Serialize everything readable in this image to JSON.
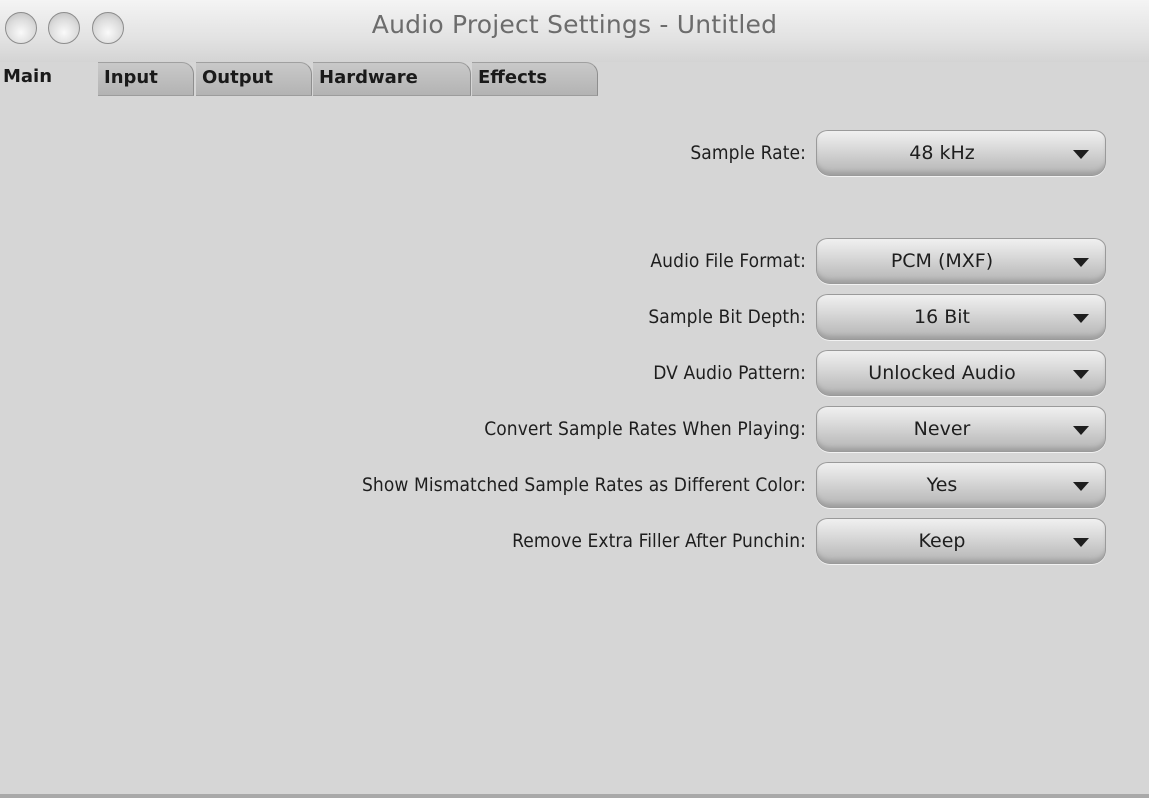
{
  "window": {
    "title": "Audio Project Settings - Untitled"
  },
  "tabs": [
    {
      "label": "Main",
      "active": true
    },
    {
      "label": "Input",
      "active": false
    },
    {
      "label": "Output",
      "active": false
    },
    {
      "label": "Hardware",
      "active": false
    },
    {
      "label": "Effects",
      "active": false
    }
  ],
  "settings": {
    "sample_rate": {
      "label": "Sample Rate:",
      "value": "48 kHz"
    },
    "audio_file_format": {
      "label": "Audio File Format:",
      "value": "PCM  (MXF)"
    },
    "sample_bit_depth": {
      "label": "Sample Bit Depth:",
      "value": "16 Bit"
    },
    "dv_audio_pattern": {
      "label": "DV Audio Pattern:",
      "value": "Unlocked Audio"
    },
    "convert_sample_rates": {
      "label": "Convert Sample Rates When Playing:",
      "value": "Never"
    },
    "show_mismatched": {
      "label": "Show Mismatched Sample Rates as Different Color:",
      "value": "Yes"
    },
    "remove_extra_filler": {
      "label": "Remove Extra Filler After Punchin:",
      "value": "Keep"
    }
  }
}
